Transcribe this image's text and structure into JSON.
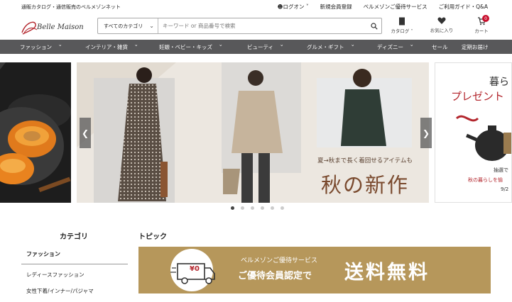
{
  "topbar": {
    "tagline": "通販カタログ・通信販売のベルメゾンネット",
    "login": "ログオン",
    "register": "新規会員登録",
    "premium": "ベルメゾンご優待サービス",
    "guide": "ご利用ガイド・Q&A"
  },
  "header": {
    "logo_text": "Belle Maison",
    "search_category": "すべてのカテゴリ",
    "search_placeholder": "キーワード or 商品番号で検索",
    "catalog": "カタログ",
    "favorites": "お気に入り",
    "cart": "カート",
    "cart_count": "0"
  },
  "nav": {
    "items": [
      "ファッション",
      "インテリア・雑貨",
      "妊娠・ベビー・キッズ",
      "ビューティ",
      "グルメ・ギフト",
      "ディズニー",
      "セール",
      "定期お届け"
    ]
  },
  "hero": {
    "main_sub": "夏→秋まで長く着回せるアイテムも",
    "main_title": "秋の新作",
    "right_t1": "暮ら",
    "right_t2": "プレゼント",
    "right_t3": "抽選で",
    "right_t4": "秋の暮らしを愉",
    "right_t5": "9/2",
    "dots": 6,
    "active_dot": 0
  },
  "sidebar": {
    "title": "カテゴリ",
    "items": [
      "ファッション",
      "レディースファッション",
      "女性下着/インナー/パジャマ"
    ]
  },
  "topic": {
    "title": "トピック",
    "banner_small": "ベルメゾンご優待サービス",
    "banner_mid": "ご優待会員認定で",
    "banner_free": "送料無料",
    "banner_icon_text": "¥0"
  },
  "colors": {
    "nav_bg": "#58585a",
    "banner_bg": "#b6975b",
    "accent_red": "#c8102e"
  }
}
